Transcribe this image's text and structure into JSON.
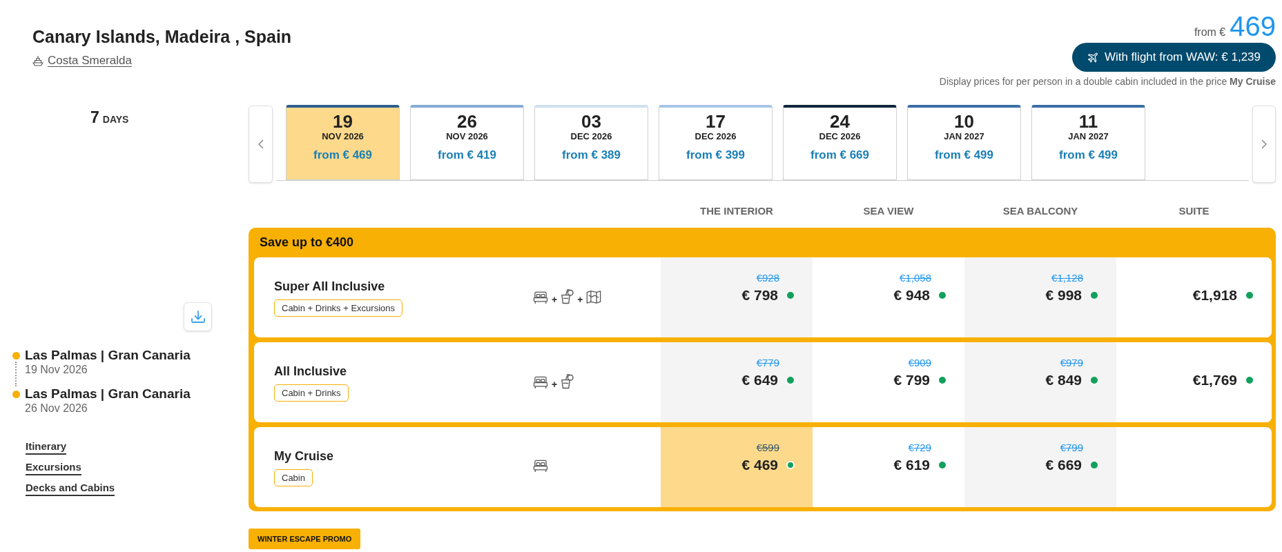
{
  "header": {
    "title": "Canary Islands, Madeira , Spain",
    "ship": "Costa Smeralda",
    "price_prefix": "from €",
    "price": "469",
    "flight_button": "With flight from WAW: € 1,239",
    "note": "Display prices for per person in a double cabin included in the price **My Cruise**"
  },
  "duration": {
    "number": "7",
    "unit": "DAYS"
  },
  "route": [
    {
      "port": "Las Palmas | Gran Canaria",
      "date": "19 Nov 2026"
    },
    {
      "port": "Las Palmas | Gran Canaria",
      "date": "26 Nov 2026"
    }
  ],
  "links": [
    "Itinerary",
    "Excursions",
    "Decks and Cabins"
  ],
  "dates": [
    {
      "day": "19",
      "month": "NOV 2026",
      "price": "from € 469",
      "selected": true,
      "color": "#2f5f8f"
    },
    {
      "day": "26",
      "month": "NOV 2026",
      "price": "from € 419",
      "selected": false,
      "color": "#85abd8"
    },
    {
      "day": "03",
      "month": "DEC 2026",
      "price": "from € 389",
      "selected": false,
      "color": "#cfe0f0"
    },
    {
      "day": "17",
      "month": "DEC 2026",
      "price": "from € 399",
      "selected": false,
      "color": "#a6c6e8"
    },
    {
      "day": "24",
      "month": "DEC 2026",
      "price": "from € 669",
      "selected": false,
      "color": "#10263a"
    },
    {
      "day": "10",
      "month": "JAN 2027",
      "price": "from € 499",
      "selected": false,
      "color": "#3a6ea5"
    },
    {
      "day": "11",
      "month": "JAN 2027",
      "price": "from € 499",
      "selected": false,
      "color": "#3a6ea5"
    }
  ],
  "fare_table": {
    "columns": [
      "THE INTERIOR",
      "SEA VIEW",
      "SEA BALCONY",
      "SUITE"
    ],
    "banner": "Save up to €400",
    "rows": [
      {
        "name": "Super All Inclusive",
        "includes": "Cabin + Drinks + Excursions",
        "amenities": [
          {
            "kind": "bed"
          },
          {
            "kind": "drink",
            "joiner": "+"
          },
          {
            "kind": "map",
            "joiner": "+"
          }
        ],
        "prices": [
          {
            "old": "€928",
            "price": "€ 798",
            "selected": false
          },
          {
            "old": "€1,058",
            "price": "€ 948",
            "selected": false
          },
          {
            "old": "€1,128",
            "price": "€ 998",
            "selected": false
          },
          {
            "price": "€1,918",
            "selected": false
          }
        ]
      },
      {
        "name": "All Inclusive",
        "includes": "Cabin + Drinks",
        "amenities": [
          {
            "kind": "bed"
          },
          {
            "kind": "drink",
            "joiner": "+"
          }
        ],
        "prices": [
          {
            "old": "€779",
            "price": "€ 649",
            "selected": false
          },
          {
            "old": "€909",
            "price": "€ 799",
            "selected": false
          },
          {
            "old": "€979",
            "price": "€ 849",
            "selected": false
          },
          {
            "price": "€1,769",
            "selected": false
          }
        ]
      },
      {
        "name": "My Cruise",
        "includes": "Cabin",
        "amenities": [
          {
            "kind": "bed"
          }
        ],
        "prices": [
          {
            "old": "€599",
            "price": "€ 469",
            "selected": true
          },
          {
            "old": "€729",
            "price": "€ 619",
            "selected": false
          },
          {
            "old": "€799",
            "price": "€ 669",
            "selected": false
          }
        ]
      }
    ]
  },
  "promo": "WINTER ESCAPE PROMO"
}
